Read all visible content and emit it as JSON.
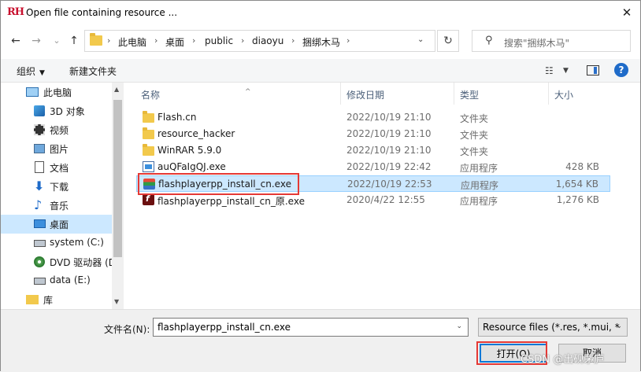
{
  "window": {
    "app_logo": "RH",
    "title": "Open file containing resource ...",
    "close_glyph": "✕"
  },
  "nav": {
    "back_glyph": "←",
    "forward_glyph": "→",
    "recent_glyph": "⌄",
    "up_glyph": "↑",
    "breadcrumbs": [
      "此电脑",
      "桌面",
      "public",
      "diaoyu",
      "捆绑木马"
    ],
    "refresh_glyph": "↻",
    "search_placeholder": "搜索\"捆绑木马\""
  },
  "toolbar": {
    "organize": "组织",
    "new_folder": "新建文件夹"
  },
  "sidebar": {
    "items": [
      {
        "label": "此电脑",
        "icon": "computer-icon"
      },
      {
        "label": "3D 对象",
        "icon": "cube-icon"
      },
      {
        "label": "视频",
        "icon": "video-icon"
      },
      {
        "label": "图片",
        "icon": "picture-icon"
      },
      {
        "label": "文档",
        "icon": "document-icon"
      },
      {
        "label": "下载",
        "icon": "download-icon"
      },
      {
        "label": "音乐",
        "icon": "music-icon"
      },
      {
        "label": "桌面",
        "icon": "desktop-icon"
      },
      {
        "label": "system (C:)",
        "icon": "drive-icon"
      },
      {
        "label": "DVD 驱动器 (D",
        "icon": "dvd-icon"
      },
      {
        "label": "data (E:)",
        "icon": "drive-icon"
      },
      {
        "label": "库",
        "icon": "library-icon"
      }
    ],
    "selected_index": 7
  },
  "columns": {
    "name": "名称",
    "date": "修改日期",
    "type": "类型",
    "size": "大小"
  },
  "files": [
    {
      "name": "Flash.cn",
      "date": "2022/10/19 21:10",
      "type": "文件夹",
      "size": "",
      "icon": "folder-icon"
    },
    {
      "name": "resource_hacker",
      "date": "2022/10/19 21:10",
      "type": "文件夹",
      "size": "",
      "icon": "folder-icon"
    },
    {
      "name": "WinRAR 5.9.0",
      "date": "2022/10/19 21:10",
      "type": "文件夹",
      "size": "",
      "icon": "folder-icon"
    },
    {
      "name": "auQFaIgQJ.exe",
      "date": "2022/10/19 22:42",
      "type": "应用程序",
      "size": "428 KB",
      "icon": "exe-icon"
    },
    {
      "name": "flashplayerpp_install_cn.exe",
      "date": "2022/10/19 22:53",
      "type": "应用程序",
      "size": "1,654 KB",
      "icon": "flash-installer-icon"
    },
    {
      "name": "flashplayerpp_install_cn_原.exe",
      "date": "2020/4/22 12:55",
      "type": "应用程序",
      "size": "1,276 KB",
      "icon": "flash-icon"
    }
  ],
  "selected_file_index": 4,
  "footer": {
    "filename_label": "文件名(N):",
    "filename_value": "flashplayerpp_install_cn.exe",
    "filter_value": "Resource files (*.res, *.mui, *",
    "open_label": "打开(O)",
    "cancel_label": "取消",
    "watermark": "CSDN @出砚茅庐"
  },
  "colors": {
    "selection": "#cce8ff",
    "highlight_box": "#e53935",
    "accent": "#0078d7"
  }
}
